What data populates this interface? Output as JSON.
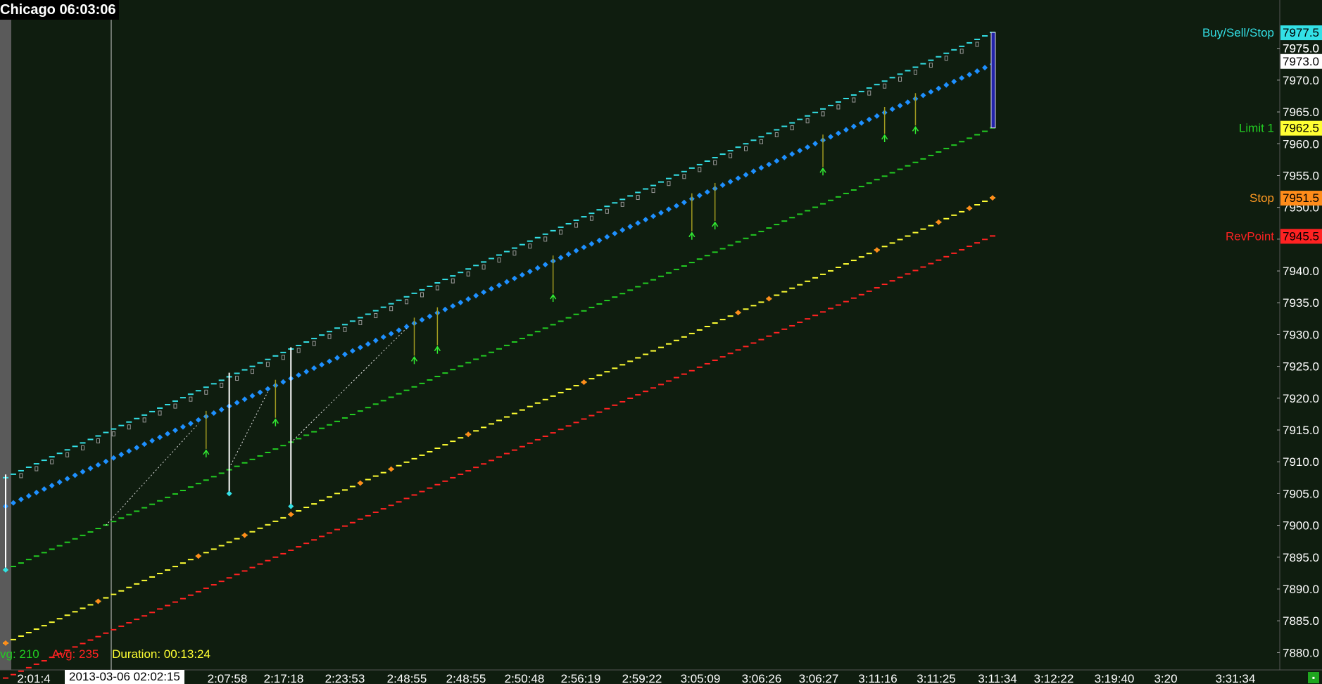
{
  "chart_data": {
    "type": "line",
    "title": "Chicago 06:03:06",
    "y_ticks": [
      7880,
      7885,
      7890,
      7895,
      7900,
      7905,
      7910,
      7915,
      7920,
      7925,
      7930,
      7935,
      7940,
      7945,
      7950,
      7955,
      7960,
      7965,
      7970,
      7975
    ],
    "ylim": [
      7877.5,
      7979.5
    ],
    "x_tick_labels": [
      "2:01:4",
      "2:07:58",
      "2:17:18",
      "2:23:53",
      "2:48:55",
      "2:48:55",
      "2:50:48",
      "2:56:19",
      "2:59:22",
      "3:05:09",
      "3:06:26",
      "3:06:27",
      "3:11:16",
      "3:11:25",
      "3:11:34",
      "3:12:22",
      "3:19:40",
      "3:20",
      "3:31:34"
    ],
    "bar_count": 129,
    "series": [
      {
        "key": "buy_sell_stop",
        "name": "Buy/Sell/Stop",
        "color": "#33e0e6",
        "start": 7907.5,
        "end": 7977.5
      },
      {
        "key": "blue_markers",
        "color": "#1e90ff",
        "start": 7903.0,
        "end": 7972.5
      },
      {
        "key": "limit1",
        "name": "Limit 1",
        "color": "#22cc22",
        "start": 7893.0,
        "end": 7962.5
      },
      {
        "key": "stop",
        "name": "Stop",
        "color": "#ffff33",
        "start": 7881.5,
        "end": 7951.5
      },
      {
        "key": "revpoint",
        "name": "RevPoint",
        "color": "#ff2222",
        "start": 7876.0,
        "end": 7945.5
      }
    ],
    "right_labels": [
      {
        "text": "Buy/Sell/Stop",
        "value": 7977.5,
        "color": "#33e0e6",
        "box_text": "7977.5",
        "box_bg": "#33e0e6",
        "box_fg": "#000000"
      },
      {
        "text": "",
        "value": 7975.0,
        "color": "#ffffff",
        "box_text": "7975.0",
        "box_bg": "",
        "box_fg": "#ffffff"
      },
      {
        "text": "",
        "value": 7973.0,
        "color": "#ffffff",
        "box_text": "7973.0",
        "box_bg": "#ffffff",
        "box_fg": "#000000"
      },
      {
        "text": "Limit 1",
        "value": 7962.5,
        "color": "#22cc22",
        "box_text": "7962.5",
        "box_bg": "#ffff33",
        "box_fg": "#000000"
      },
      {
        "text": "Stop",
        "value": 7951.5,
        "color": "#ff9922",
        "box_text": "7951.5",
        "box_bg": "#ff8c1a",
        "box_fg": "#000000"
      },
      {
        "text": "RevPoint",
        "value": 7945.5,
        "color": "#ff2222",
        "box_text": "7945.5",
        "box_bg": "#ff2222",
        "box_fg": "#000000"
      }
    ],
    "grid": false,
    "legend": "none"
  },
  "header": {
    "title": "Chicago 06:03:06"
  },
  "footer": {
    "avg1": "vg: 210",
    "avg2": "Avg: 235",
    "duration": "Duration: 00:13:24",
    "date_label": "2013-03-06  02:02:15"
  },
  "colors": {
    "background": "#0f1d0f",
    "axis_text": "#ffffff",
    "avg1_color": "#22cc22",
    "avg2_color": "#ff2222",
    "duration_color": "#ffff33"
  }
}
